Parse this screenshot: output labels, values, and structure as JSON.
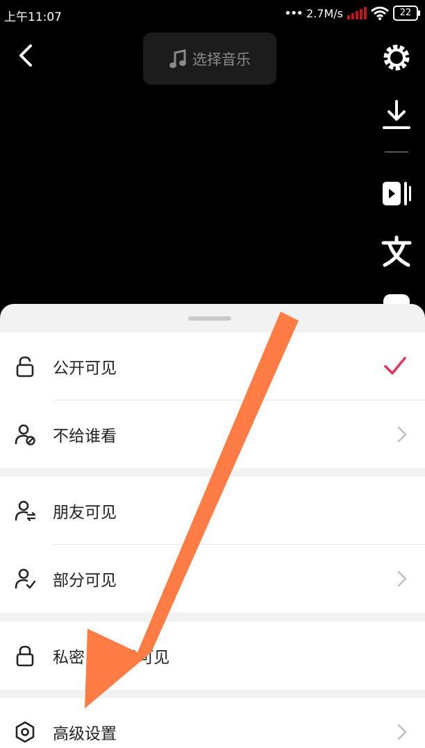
{
  "status_bar": {
    "time": "上午11:07",
    "network_speed": "2.7M/s",
    "battery": "22"
  },
  "toolbar": {
    "music_label": "选择音乐"
  },
  "sheet": {
    "groups": [
      {
        "items": [
          {
            "label": "公开可见",
            "icon": "unlock-icon",
            "trailing": "check",
            "selected": true
          },
          {
            "label": "不给谁看",
            "icon": "user-block-icon",
            "trailing": "chevron"
          }
        ]
      },
      {
        "items": [
          {
            "label": "朋友可见",
            "icon": "user-friends-icon",
            "trailing": "none"
          },
          {
            "label": "部分可见",
            "icon": "user-check-icon",
            "trailing": "chevron"
          }
        ]
      },
      {
        "items": [
          {
            "label": "私密 仅自己可见",
            "icon": "lock-icon",
            "trailing": "none"
          }
        ]
      },
      {
        "items": [
          {
            "label": "高级设置",
            "icon": "hexagon-settings-icon",
            "trailing": "chevron"
          }
        ]
      }
    ]
  },
  "colors": {
    "accent_check": "#e5325b",
    "arrow": "#ff7d45",
    "background": "#000000",
    "sheet_bg": "#f2f2f2"
  }
}
